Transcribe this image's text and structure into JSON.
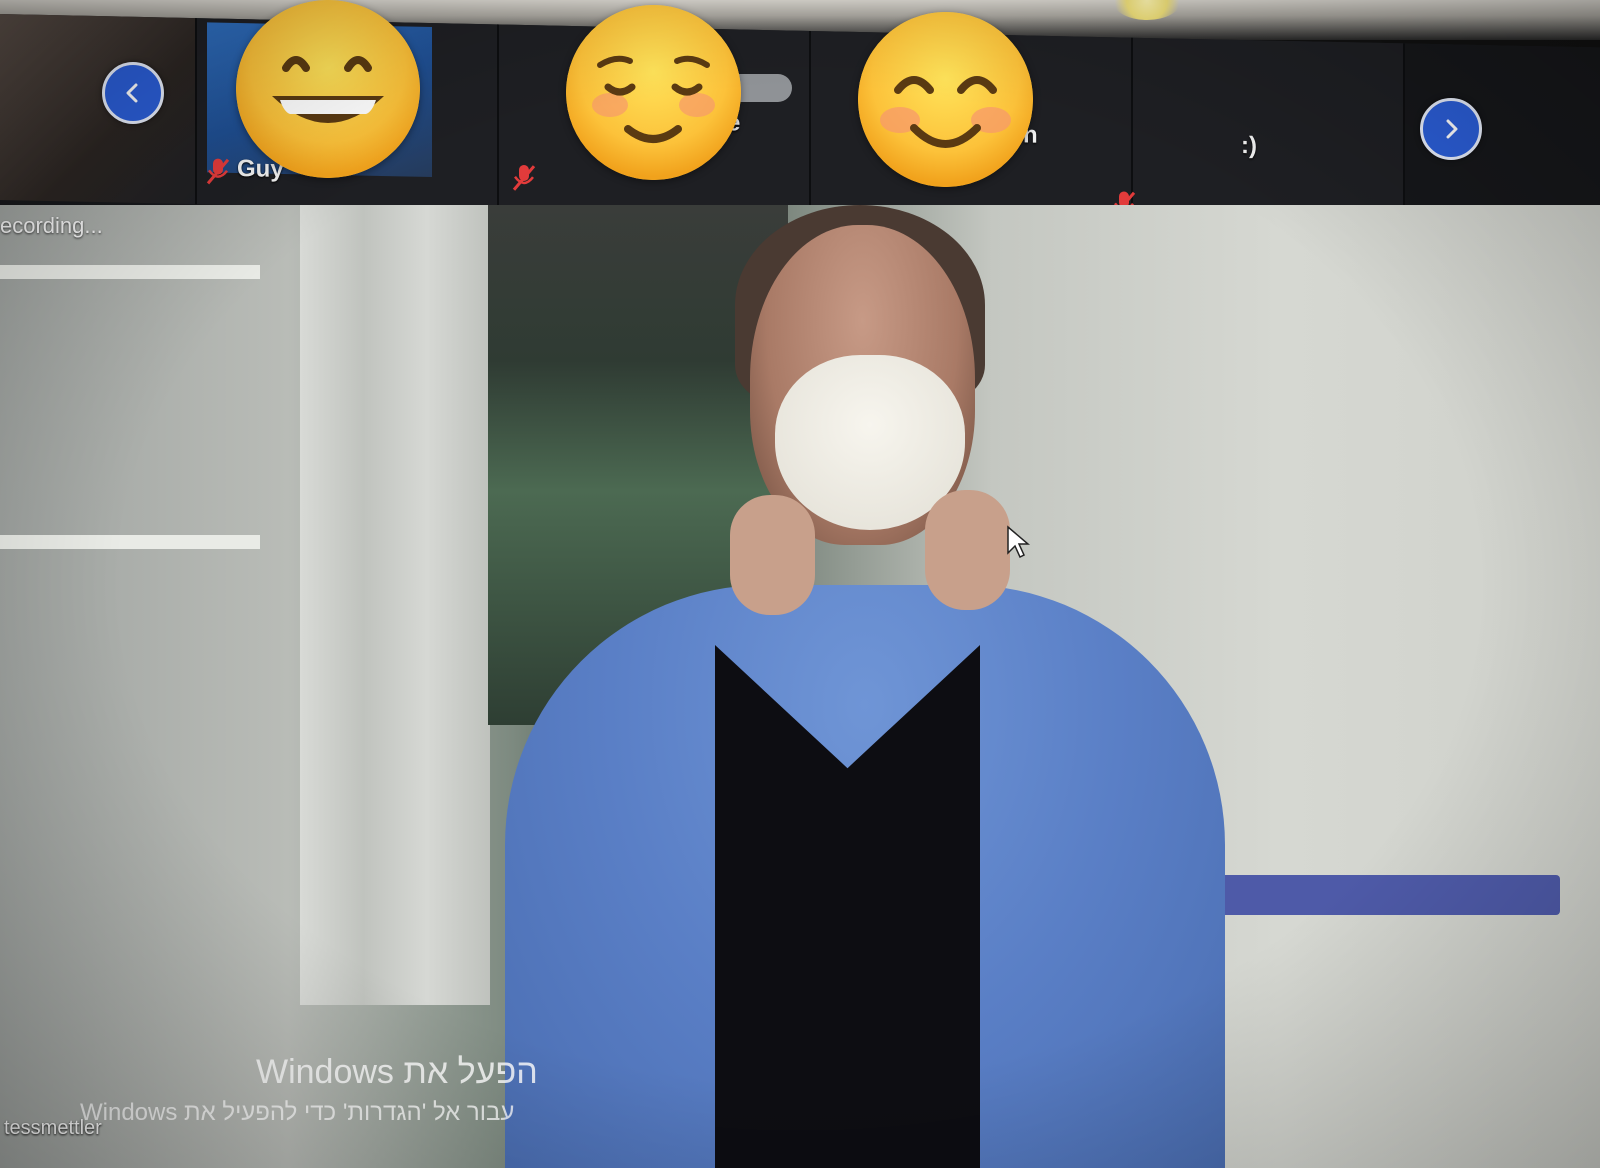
{
  "participants": [
    {
      "name": "Guy",
      "muted": true,
      "emoji": "grinning-face-icon"
    },
    {
      "name": "e",
      "muted": true,
      "emoji": "smiling-face-icon"
    },
    {
      "name": "n",
      "muted": true,
      "emoji": "smiling-face-with-smiling-eyes-icon"
    },
    {
      "name": ":)",
      "muted": false
    }
  ],
  "main_video": {
    "status_text": "ecording...",
    "speaker_name": "tessmettler"
  },
  "windows_watermark": {
    "line1": "הפעל את Windows",
    "line2": "עבור אל 'הגדרות' כדי להפעיל את Windows"
  },
  "colors": {
    "nav_button": "#2b5ed8",
    "strip_bg": "#1b1d21",
    "muted_red": "#e23b3b"
  }
}
